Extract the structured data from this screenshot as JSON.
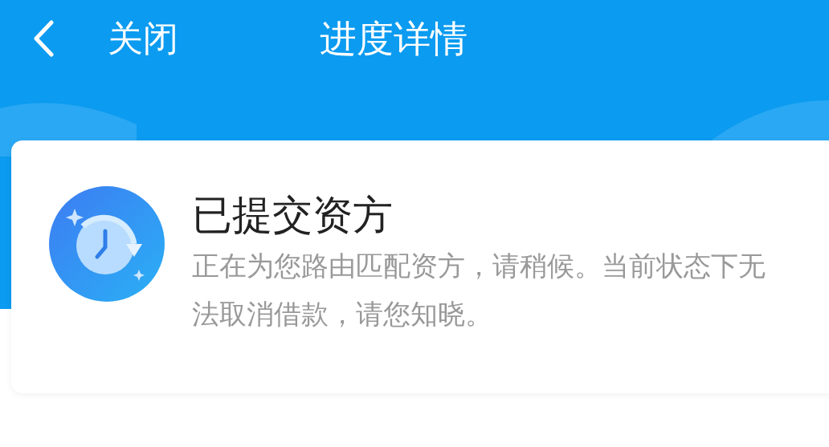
{
  "header": {
    "close_label": "关闭",
    "title": "进度详情"
  },
  "status": {
    "title": "已提交资方",
    "description": "正在为您路由匹配资方，请稍候。当前状态下无法取消借款，请您知晓。"
  }
}
